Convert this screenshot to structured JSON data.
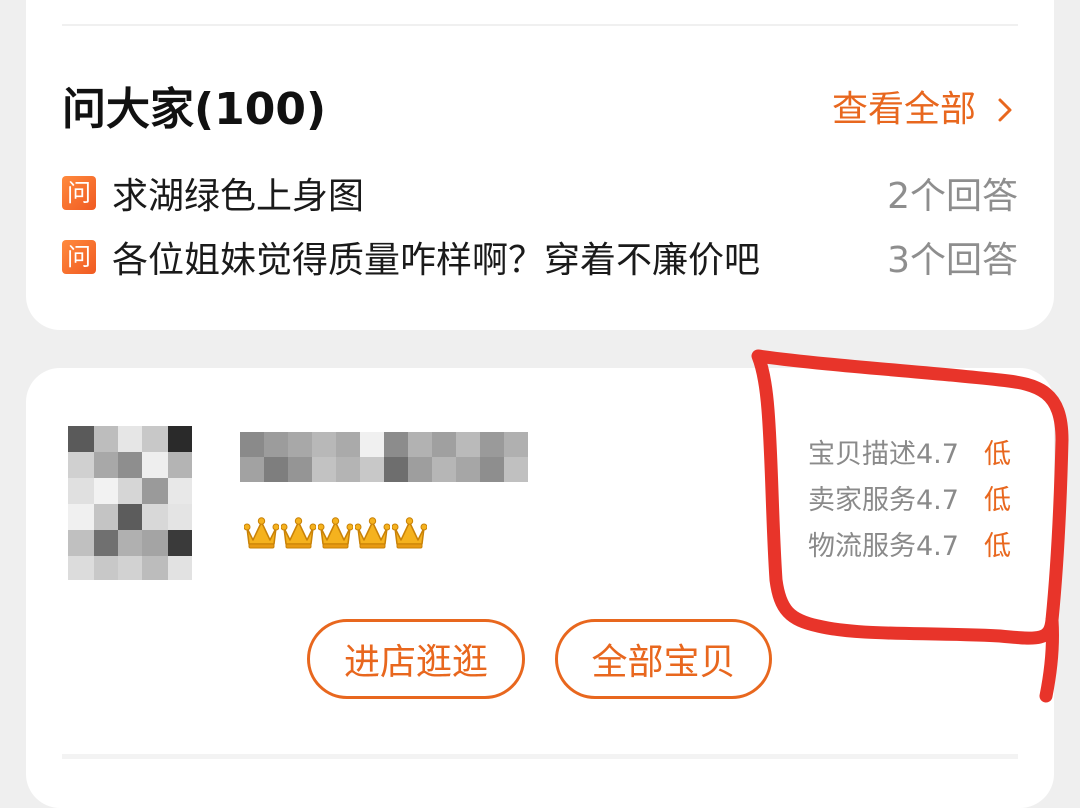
{
  "qa": {
    "title": "问大家(100)",
    "see_all": "查看全部",
    "badge": "问",
    "questions": [
      {
        "text": "求湖绿色上身图",
        "answers": "2个回答"
      },
      {
        "text": "各位姐妹觉得质量咋样啊？穿着不廉价吧",
        "answers": "3个回答"
      }
    ]
  },
  "shop": {
    "crown_count": 5,
    "ratings": [
      {
        "label": "宝贝描述4.7",
        "level": "低"
      },
      {
        "label": "卖家服务4.7",
        "level": "低"
      },
      {
        "label": "物流服务4.7",
        "level": "低"
      }
    ],
    "enter_button": "进店逛逛",
    "all_items_button": "全部宝贝"
  },
  "colors": {
    "accent": "#e8671e",
    "annotation": "#e8342a"
  }
}
